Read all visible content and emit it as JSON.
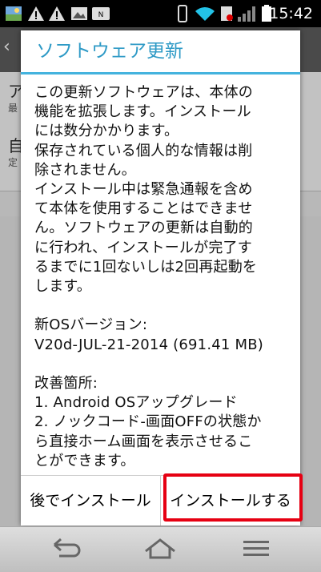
{
  "status_bar": {
    "time": "15:42",
    "icons": [
      "gallery-notification-icon",
      "warning-icon",
      "warning-icon",
      "image-icon",
      "nfc-icon",
      "vibrate-icon",
      "wifi-icon",
      "sim-icon",
      "signal-icon",
      "battery-icon"
    ]
  },
  "dialog": {
    "title": "ソフトウェア更新",
    "body": "この更新ソフトウェアは、本体の\n機能を拡張します。インストール\nには数分かかります。\n保存されている個人的な情報は削\n除されません。\nインストール中は緊急通報を含め\nて本体を使用することはできませ\nん。ソフトウェアの更新は自動的\nに行われ、インストールが完了す\nるまでに1回ないしは2回再起動を\nします。\n\n新OSバージョン:\nV20d-JUL-21-2014 (691.41 MB)\n\n改善箇所:\n1. Android OSアップグレード\n2. ノックコード-画面OFFの状態か\nら直接ホーム画面を表示させるこ\nとができます。",
    "later_button": "後でインストール",
    "install_button": "インストールする"
  },
  "background": {
    "row1_title": "ア",
    "row1_sub": "最",
    "row2_title": "自",
    "row2_sub": "定"
  },
  "colors": {
    "title": "#2e9ac6",
    "title_line": "#44b3de",
    "highlight": "#e60012"
  }
}
